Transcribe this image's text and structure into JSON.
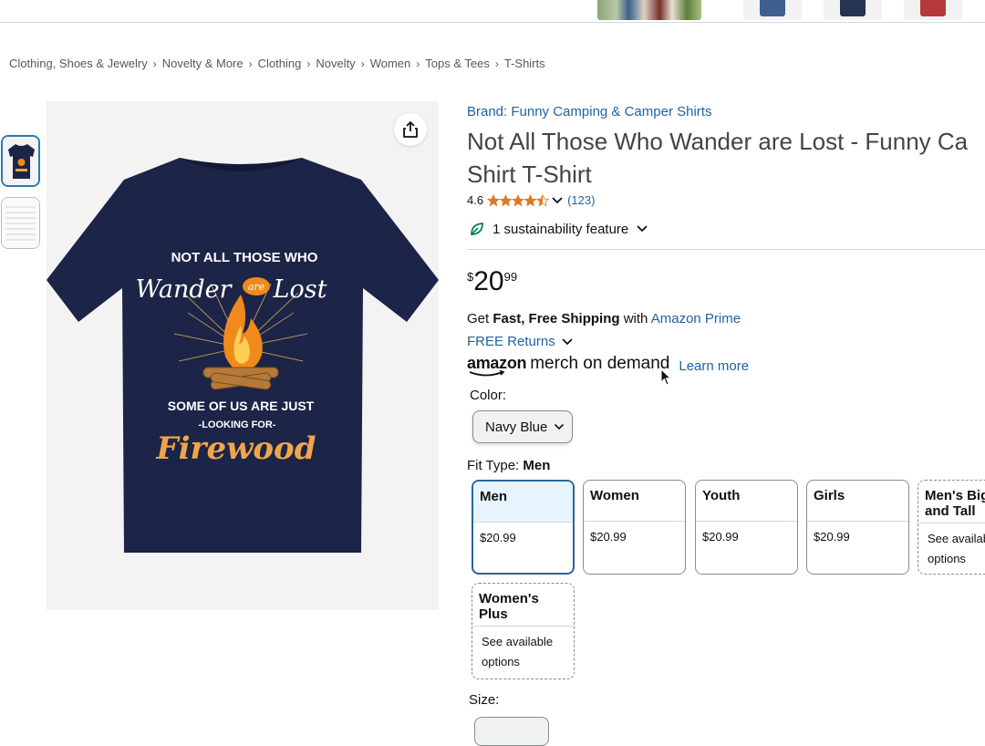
{
  "top_strip": {
    "thumbnails": [
      "photo",
      "navy-shirt",
      "navy-shirt-dark",
      "red-shirt"
    ]
  },
  "breadcrumb": [
    "Clothing, Shoes & Jewelry",
    "Novelty & More",
    "Clothing",
    "Novelty",
    "Women",
    "Tops & Tees",
    "T-Shirts"
  ],
  "breadcrumb_separator": "›",
  "product": {
    "brand_link": "Brand: Funny Camping & Camper Shirts",
    "title_line1": "Not All Those Who Wander are Lost - Funny Ca",
    "title_line2": "Shirt T-Shirt",
    "rating": "4.6",
    "stars": 4.5,
    "rating_count": "(123)",
    "sustainability": "1 sustainability feature",
    "price_symbol": "$",
    "price_whole": "20",
    "price_fraction": "99",
    "shipping_prefix": "Get ",
    "shipping_bold": "Fast, Free Shipping",
    "shipping_with": " with ",
    "shipping_link": "Amazon Prime",
    "returns": "FREE Returns",
    "merch_brand": "amazon",
    "merch_text": "merch on demand",
    "learn_more": "Learn more",
    "color_label": "Color:",
    "color_value": "Navy Blue",
    "fit_label": "Fit Type: ",
    "fit_value": "Men",
    "fit_types": [
      {
        "name": "Men",
        "price": "$20.99"
      },
      {
        "name": "Women",
        "price": "$20.99"
      },
      {
        "name": "Youth",
        "price": "$20.99"
      },
      {
        "name": "Girls",
        "price": "$20.99"
      },
      {
        "name": "Men's Big and Tall",
        "price": "See available options"
      },
      {
        "name": "Women's Plus",
        "price": "See available options"
      }
    ],
    "size_label": "Size:"
  },
  "shirt_print": {
    "line1": "NOT ALL THOSE WHO",
    "line2a": "Wander",
    "line2b": "are",
    "line2c": "Lost",
    "line3": "SOME OF US ARE JUST",
    "line4": "-LOOKING FOR-",
    "line5": "Firewood"
  },
  "colors": {
    "link": "#2162a1",
    "selected_border": "#2a6598",
    "selected_bg": "#e7f4fd",
    "star": "#de7921",
    "shirt": "#1c2447",
    "flame": "#f08a1c"
  }
}
